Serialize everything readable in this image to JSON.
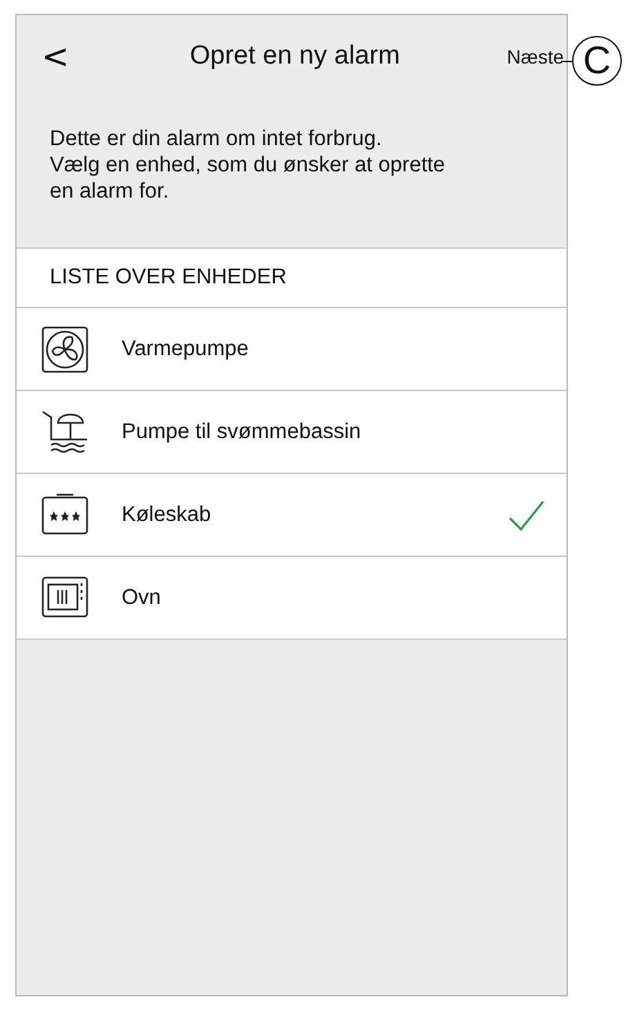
{
  "header": {
    "back": "<",
    "title": "Opret en ny alarm",
    "next": "Næste"
  },
  "callout": {
    "label": "C"
  },
  "description": "Dette er din alarm om intet forbrug.\nVælg en enhed, som du ønsker at oprette en alarm for.",
  "list": {
    "heading": "LISTE OVER ENHEDER",
    "items": [
      {
        "kind": "fan",
        "label": "Varmepumpe",
        "selected": false
      },
      {
        "kind": "pool",
        "label": "Pumpe til svømmebassin",
        "selected": false
      },
      {
        "kind": "fridge",
        "label": "Køleskab",
        "selected": true
      },
      {
        "kind": "oven",
        "label": "Ovn",
        "selected": false
      }
    ]
  }
}
